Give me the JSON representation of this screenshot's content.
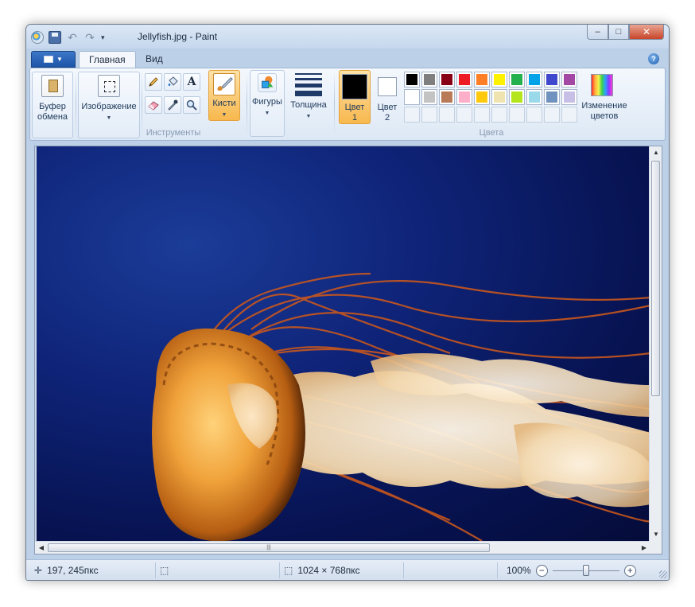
{
  "window": {
    "title": "Jellyfish.jpg - Paint",
    "qat_icons": [
      "paint-app-icon",
      "save-icon",
      "undo-icon",
      "redo-icon",
      "customize-dropdown-icon"
    ],
    "controls": {
      "minimize": "–",
      "maximize": "□",
      "close": "✕"
    }
  },
  "tabs": [
    {
      "label": "Главная",
      "active": true
    },
    {
      "label": "Вид",
      "active": false
    }
  ],
  "help_label": "?",
  "ribbon": {
    "clipboard": {
      "label_line1": "Буфер",
      "label_line2": "обмена"
    },
    "image": {
      "label": "Изображение"
    },
    "tools": {
      "group_label": "Инструменты",
      "items": [
        "pencil-icon",
        "fill-icon",
        "text-icon",
        "eraser-icon",
        "color-picker-icon",
        "magnifier-icon"
      ],
      "text_glyph": "A"
    },
    "brushes": {
      "label": "Кисти",
      "active": true
    },
    "shapes": {
      "label": "Фигуры"
    },
    "thickness": {
      "label": "Толщина"
    },
    "colors": {
      "group_label": "Цвета",
      "color1": {
        "label_line1": "Цвет",
        "label_line2": "1",
        "value": "#000000",
        "active": true
      },
      "color2": {
        "label_line1": "Цвет",
        "label_line2": "2",
        "value": "#ffffff"
      },
      "palette_row1": [
        "#000000",
        "#7f7f7f",
        "#880015",
        "#ed1c24",
        "#ff7f27",
        "#fff200",
        "#22b14c",
        "#00a2e8",
        "#3f48cc",
        "#a349a4"
      ],
      "palette_row2": [
        "#ffffff",
        "#c3c3c3",
        "#b97a57",
        "#ffaec9",
        "#ffc90e",
        "#efe4b0",
        "#b5e61d",
        "#99d9ea",
        "#7092be",
        "#c8bfe7"
      ],
      "palette_row3_empty": 10,
      "edit": {
        "label_line1": "Изменение",
        "label_line2": "цветов"
      }
    }
  },
  "canvas": {
    "image_name": "Jellyfish.jpg"
  },
  "statusbar": {
    "cursor_pos": "197, 245пкс",
    "image_size": "1024 × 768пкс",
    "zoom": "100%",
    "zoom_minus": "−",
    "zoom_plus": "+",
    "zoom_slider_fraction": 0.5
  }
}
